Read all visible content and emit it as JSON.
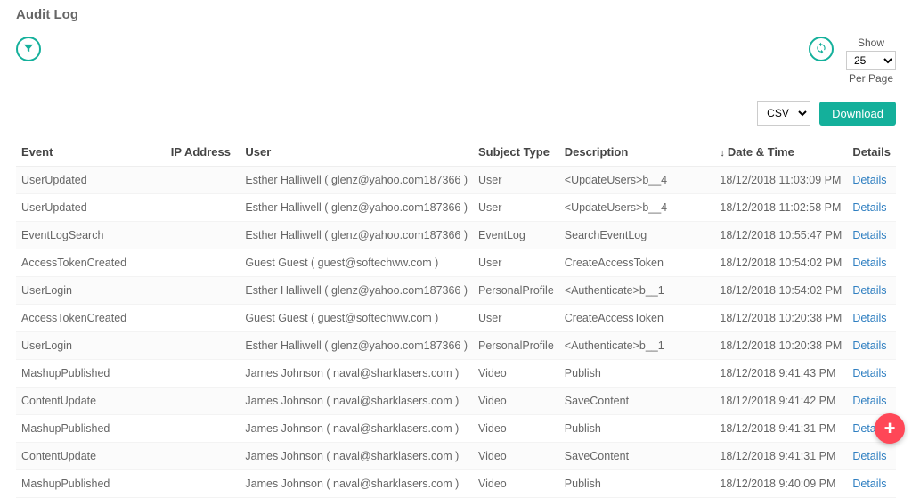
{
  "page_title": "Audit Log",
  "toolbar": {
    "show_label": "Show",
    "per_page_label": "Per Page",
    "page_size": "25"
  },
  "export": {
    "format": "CSV",
    "download_label": "Download"
  },
  "columns": {
    "event": "Event",
    "ip": "IP Address",
    "user": "User",
    "subject": "Subject Type",
    "desc": "Description",
    "date": "Date & Time",
    "details": "Details"
  },
  "details_link_label": "Details",
  "rows": [
    {
      "event": "UserUpdated",
      "ip": "",
      "user": "Esther Halliwell ( glenz@yahoo.com187366 )",
      "subject": "User",
      "desc": "<UpdateUsers>b__4",
      "date": "18/12/2018 11:03:09 PM"
    },
    {
      "event": "UserUpdated",
      "ip": "",
      "user": "Esther Halliwell ( glenz@yahoo.com187366 )",
      "subject": "User",
      "desc": "<UpdateUsers>b__4",
      "date": "18/12/2018 11:02:58 PM"
    },
    {
      "event": "EventLogSearch",
      "ip": "",
      "user": "Esther Halliwell ( glenz@yahoo.com187366 )",
      "subject": "EventLog",
      "desc": "SearchEventLog",
      "date": "18/12/2018 10:55:47 PM"
    },
    {
      "event": "AccessTokenCreated",
      "ip": "",
      "user": "Guest Guest ( guest@softechww.com )",
      "subject": "User",
      "desc": "CreateAccessToken",
      "date": "18/12/2018 10:54:02 PM"
    },
    {
      "event": "UserLogin",
      "ip": "",
      "user": "Esther Halliwell ( glenz@yahoo.com187366 )",
      "subject": "PersonalProfile",
      "desc": "<Authenticate>b__1",
      "date": "18/12/2018 10:54:02 PM"
    },
    {
      "event": "AccessTokenCreated",
      "ip": "",
      "user": "Guest Guest ( guest@softechww.com )",
      "subject": "User",
      "desc": "CreateAccessToken",
      "date": "18/12/2018 10:20:38 PM"
    },
    {
      "event": "UserLogin",
      "ip": "",
      "user": "Esther Halliwell ( glenz@yahoo.com187366 )",
      "subject": "PersonalProfile",
      "desc": "<Authenticate>b__1",
      "date": "18/12/2018 10:20:38 PM"
    },
    {
      "event": "MashupPublished",
      "ip": "",
      "user": "James Johnson ( naval@sharklasers.com )",
      "subject": "Video",
      "desc": "Publish",
      "date": "18/12/2018 9:41:43 PM"
    },
    {
      "event": "ContentUpdate",
      "ip": "",
      "user": "James Johnson ( naval@sharklasers.com )",
      "subject": "Video",
      "desc": "SaveContent",
      "date": "18/12/2018 9:41:42 PM"
    },
    {
      "event": "MashupPublished",
      "ip": "",
      "user": "James Johnson ( naval@sharklasers.com )",
      "subject": "Video",
      "desc": "Publish",
      "date": "18/12/2018 9:41:31 PM"
    },
    {
      "event": "ContentUpdate",
      "ip": "",
      "user": "James Johnson ( naval@sharklasers.com )",
      "subject": "Video",
      "desc": "SaveContent",
      "date": "18/12/2018 9:41:31 PM"
    },
    {
      "event": "MashupPublished",
      "ip": "",
      "user": "James Johnson ( naval@sharklasers.com )",
      "subject": "Video",
      "desc": "Publish",
      "date": "18/12/2018 9:40:09 PM"
    }
  ]
}
